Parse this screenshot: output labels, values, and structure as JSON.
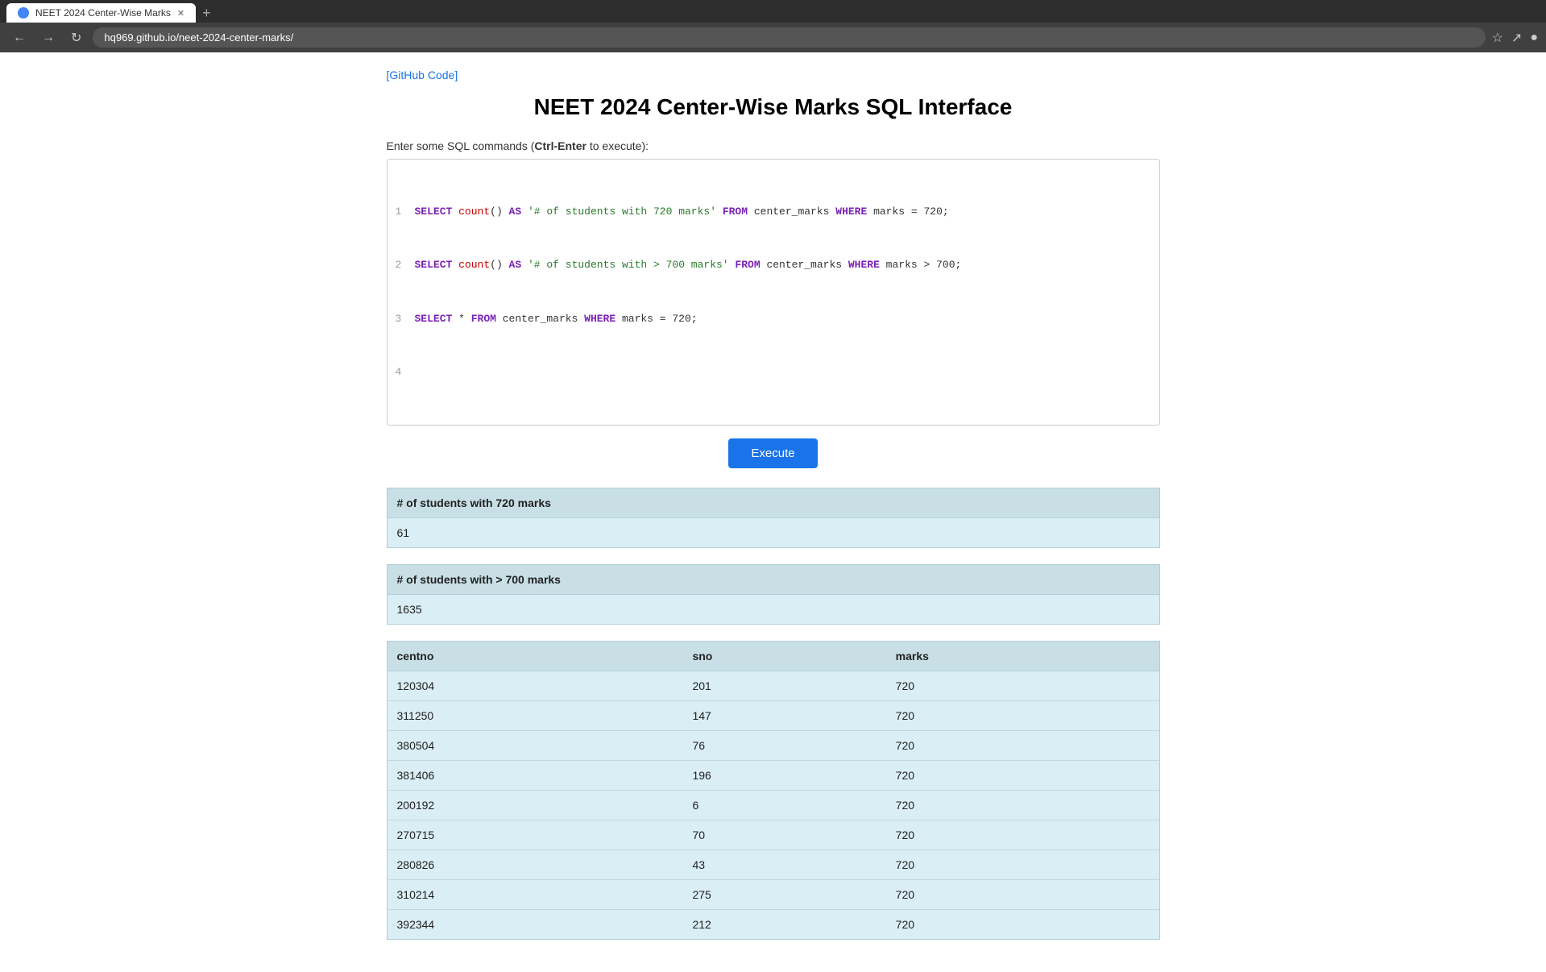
{
  "browser": {
    "tab_title": "NEET 2024 Center-Wise Marks",
    "url": "hq969.github.io/neet-2024-center-marks/",
    "new_tab_label": "+"
  },
  "page": {
    "github_link": "[GitHub Code]",
    "title": "NEET 2024 Center-Wise Marks SQL Interface",
    "sql_label": "Enter some SQL commands (",
    "sql_label_key": "Ctrl-Enter",
    "sql_label_end": " to execute):",
    "execute_button": "Execute"
  },
  "sql_lines": [
    "SELECT count() AS '# of students with 720 marks' FROM center_marks WHERE marks = 720;",
    "SELECT count() AS '# of students with > 700 marks' FROM center_marks WHERE marks > 700;",
    "SELECT * FROM center_marks WHERE marks = 720;"
  ],
  "results": {
    "table1": {
      "header": "# of students with 720 marks",
      "value": "61"
    },
    "table2": {
      "header": "# of students with > 700 marks",
      "value": "1635"
    },
    "table3": {
      "columns": [
        "centno",
        "sno",
        "marks"
      ],
      "rows": [
        [
          "120304",
          "201",
          "720"
        ],
        [
          "311250",
          "147",
          "720"
        ],
        [
          "380504",
          "76",
          "720"
        ],
        [
          "381406",
          "196",
          "720"
        ],
        [
          "200192",
          "6",
          "720"
        ],
        [
          "270715",
          "70",
          "720"
        ],
        [
          "280826",
          "43",
          "720"
        ],
        [
          "310214",
          "275",
          "720"
        ],
        [
          "392344",
          "212",
          "720"
        ]
      ]
    }
  }
}
